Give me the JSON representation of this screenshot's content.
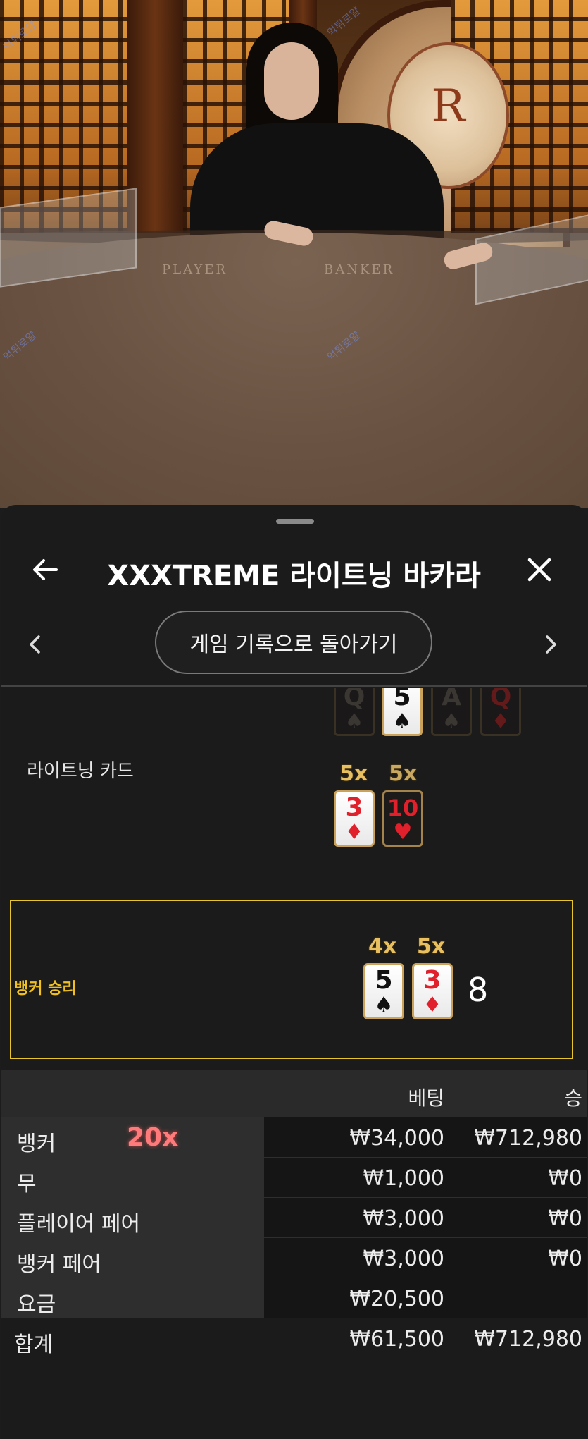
{
  "video": {
    "table_labels": [
      "PLAYER",
      "BANKER"
    ],
    "emblem_letter": "R",
    "watermark_text": "먹튀로얄"
  },
  "header": {
    "title": "XXXTREME 라이트닝 바카라",
    "back_icon": "arrow-left-icon",
    "close_icon": "close-icon"
  },
  "nav": {
    "back_to_history": "게임 기록으로 돌아가기",
    "prev_icon": "chevron-left-icon",
    "next_icon": "chevron-right-icon"
  },
  "history": {
    "top_row_cards": [
      {
        "rank": "Q",
        "suit": "♠",
        "color": "dim"
      },
      {
        "rank": "5",
        "suit": "♠",
        "color": "black"
      },
      {
        "rank": "A",
        "suit": "♠",
        "color": "dim"
      },
      {
        "rank": "Q",
        "suit": "♦",
        "color": "dimred"
      }
    ],
    "lightning_label": "라이트닝 카드",
    "lightning_cards": [
      {
        "multiplier": "5x",
        "rank": "3",
        "suit": "♦"
      },
      {
        "multiplier": "5x",
        "rank": "10",
        "suit": "♥"
      }
    ],
    "result_label": "뱅커 승리",
    "result_cards": [
      {
        "multiplier": "4x",
        "rank": "5",
        "suit": "♠"
      },
      {
        "multiplier": "5x",
        "rank": "3",
        "suit": "♦"
      }
    ],
    "result_score": "8"
  },
  "bets": {
    "header": {
      "bet": "베팅",
      "win": "승"
    },
    "rows": [
      {
        "name": "뱅커",
        "multiplier": "20x",
        "bet": "₩34,000",
        "win": "₩712,980"
      },
      {
        "name": "무",
        "bet": "₩1,000",
        "win": "₩0"
      },
      {
        "name": "플레이어 페어",
        "bet": "₩3,000",
        "win": "₩0"
      },
      {
        "name": "뱅커 페어",
        "bet": "₩3,000",
        "win": "₩0"
      },
      {
        "name": "요금",
        "bet": "₩20,500",
        "win": ""
      }
    ],
    "total": {
      "name": "합계",
      "bet": "₩61,500",
      "win": "₩712,980"
    }
  },
  "colors": {
    "accent_yellow": "#e8c52a",
    "multiplier_gold": "#e8c060",
    "multiplier_red": "#ff7a7a",
    "card_red": "#e0202a"
  }
}
